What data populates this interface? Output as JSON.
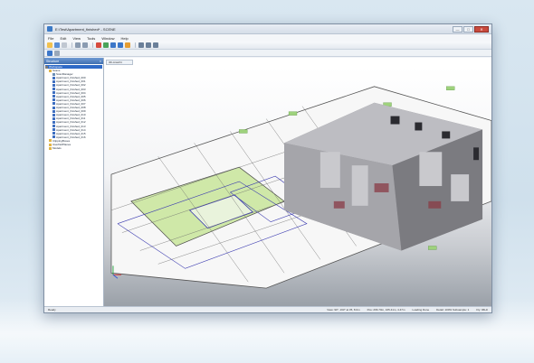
{
  "window": {
    "title": "E:\\Test\\Apartment_finished* - SCENE",
    "min_label": "—",
    "max_label": "□",
    "close_label": "✕"
  },
  "menu": [
    "File",
    "Edit",
    "View",
    "Tools",
    "Window",
    "Help"
  ],
  "panel": {
    "title": "Structure",
    "close_label": "×",
    "tree": [
      {
        "label": "Workspace",
        "icon": "root",
        "indent": 0,
        "selected": true
      },
      {
        "label": "Scans",
        "icon": "folder",
        "indent": 1
      },
      {
        "label": "ScanManager",
        "icon": "grid",
        "indent": 2
      },
      {
        "label": "Apartment_finished_000",
        "icon": "scan",
        "indent": 2
      },
      {
        "label": "Apartment_finished_001",
        "icon": "scan",
        "indent": 2
      },
      {
        "label": "Apartment_finished_002",
        "icon": "scan",
        "indent": 2
      },
      {
        "label": "Apartment_finished_003",
        "icon": "scan",
        "indent": 2
      },
      {
        "label": "Apartment_finished_004",
        "icon": "scan",
        "indent": 2
      },
      {
        "label": "Apartment_finished_005",
        "icon": "scan",
        "indent": 2
      },
      {
        "label": "Apartment_finished_006",
        "icon": "scan",
        "indent": 2
      },
      {
        "label": "Apartment_finished_007",
        "icon": "scan",
        "indent": 2
      },
      {
        "label": "Apartment_finished_008",
        "icon": "scan",
        "indent": 2
      },
      {
        "label": "Apartment_finished_009",
        "icon": "scan",
        "indent": 2
      },
      {
        "label": "Apartment_finished_010",
        "icon": "scan",
        "indent": 2
      },
      {
        "label": "Apartment_finished_011",
        "icon": "scan",
        "indent": 2
      },
      {
        "label": "Apartment_finished_012",
        "icon": "scan",
        "indent": 2
      },
      {
        "label": "Apartment_finished_013",
        "icon": "scan",
        "indent": 2
      },
      {
        "label": "Apartment_finished_014",
        "icon": "scan",
        "indent": 2
      },
      {
        "label": "Apartment_finished_015",
        "icon": "scan",
        "indent": 2
      },
      {
        "label": "Apartment_finished_016",
        "icon": "scan",
        "indent": 2
      },
      {
        "label": "ClippingBoxes",
        "icon": "folder",
        "indent": 1
      },
      {
        "label": "UserDefPlanes",
        "icon": "folder",
        "indent": 1
      },
      {
        "label": "Models",
        "icon": "folder",
        "indent": 1
      }
    ]
  },
  "view_tab": {
    "label": "3D-Ansicht"
  },
  "status": {
    "left": "Ready",
    "view": "View: 90°, 163° at 35, 8.0m",
    "pos": "Pos: 266.70m, 165.41m, 4.47m",
    "loading": "Loading Done",
    "detail": "Detail: 100%  Subsample: 1",
    "fps": "Fly: 96Hz"
  },
  "colors": {
    "accent": "#2f6ac7",
    "plan_green": "#cfe8a8",
    "label_green": "#9ed27c"
  }
}
